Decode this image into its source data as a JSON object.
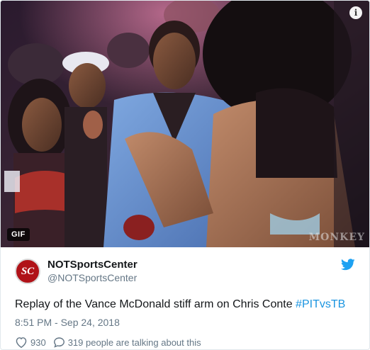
{
  "media": {
    "gif_badge": "GIF",
    "info_label": "i",
    "watermark": "MONKEY"
  },
  "tweet": {
    "display_name": "NOTSportsCenter",
    "handle": "@NOTSportsCenter",
    "avatar_text": "SC",
    "text_main": "Replay of the Vance McDonald stiff arm on Chris Conte ",
    "hashtag": "#PITvsTB",
    "timestamp": "8:51 PM - Sep 24, 2018",
    "like_count": "930",
    "talking_text": "319 people are talking about this"
  },
  "colors": {
    "accent": "#1b95e0",
    "avatar_bg": "#b01218",
    "muted": "#657786"
  },
  "icons": [
    "info-icon",
    "twitter-bird-icon",
    "heart-icon",
    "comment-bubble-icon"
  ]
}
